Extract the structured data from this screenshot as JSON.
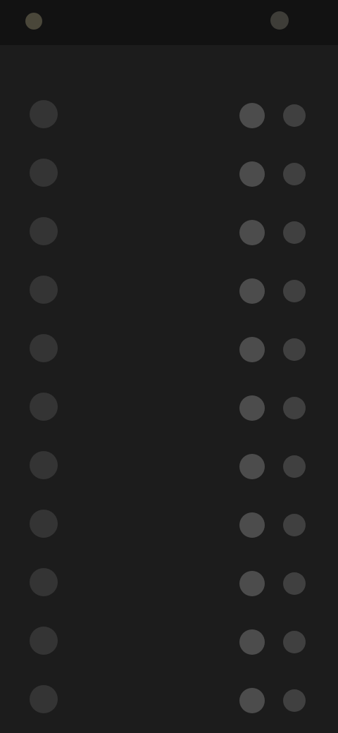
{
  "topbar": {
    "title": "",
    "logo_icon": "app-logo-icon",
    "menu_icon": "more-icon"
  },
  "section": {
    "title": ""
  },
  "colors": {
    "background": "#1c1c1c",
    "topbar": "#121212",
    "avatar": "#343434",
    "action": "#4c4c4c"
  },
  "rows": [
    {
      "name": "",
      "sub": ""
    },
    {
      "name": "",
      "sub": ""
    },
    {
      "name": "",
      "sub": ""
    },
    {
      "name": "",
      "sub": ""
    },
    {
      "name": "",
      "sub": ""
    },
    {
      "name": "",
      "sub": ""
    },
    {
      "name": "",
      "sub": ""
    },
    {
      "name": "",
      "sub": ""
    },
    {
      "name": "",
      "sub": ""
    },
    {
      "name": "",
      "sub": ""
    },
    {
      "name": "",
      "sub": ""
    }
  ]
}
